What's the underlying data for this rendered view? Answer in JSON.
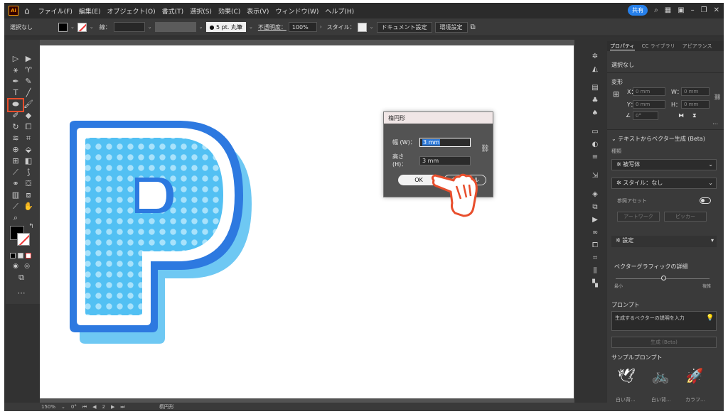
{
  "menubar": {
    "logo": "Ai",
    "items": [
      "ファイル(F)",
      "編集(E)",
      "オブジェクト(O)",
      "書式(T)",
      "選択(S)",
      "効果(C)",
      "表示(V)",
      "ウィンドウ(W)",
      "ヘルプ(H)"
    ],
    "share": "共有"
  },
  "control": {
    "selection": "選択なし",
    "stroke_label": "線：",
    "brush": "● 5 pt. 丸筆",
    "opacity_label": "不透明度：",
    "opacity_value": "100%",
    "style_label": "スタイル：",
    "doc_settings": "ドキュメント設定",
    "prefs": "環境設定"
  },
  "dialog": {
    "title": "楕円形",
    "width_label": "幅 (W)：",
    "width_value": "3 mm",
    "height_label": "高さ (H)：",
    "height_value": "3 mm",
    "ok": "OK",
    "cancel": "キャンセル"
  },
  "panel": {
    "tabs": [
      "プロパティ",
      "CC ライブラリ",
      "アピアランス"
    ],
    "selection": "選択なし",
    "transform": "変形",
    "x_label": "X：",
    "x_value": "0 mm",
    "w_label": "W：",
    "w_value": "0 mm",
    "y_label": "Y：",
    "y_value": "0 mm",
    "h_label": "H：",
    "h_value": "0 mm",
    "angle": "0°",
    "text_to_vector": "テキストからベクター生成 (Beta)",
    "type_label": "種類",
    "type_value": "被写体",
    "style_value": "スタイル：なし",
    "ref_asset": "参照アセット",
    "artwork_btn": "アートワーク",
    "picker_btn": "ピッカー",
    "settings": "設定",
    "detail_label": "ベクターグラフィックの詳細",
    "min_label": "最小",
    "max_label": "複雑",
    "prompt_label": "プロンプト",
    "prompt_placeholder": "生成するベクターの説明を入力",
    "generate_btn": "生成 (Beta)",
    "sample_label": "サンプルプロンプト",
    "samples": [
      "白い背...",
      "白い背...",
      "カラフ..."
    ]
  },
  "status": {
    "zoom": "150%",
    "rotation": "0°",
    "page": "2",
    "tool": "楕円形"
  },
  "colors": {
    "accent": "#2680eb",
    "highlight": "#e84e2c",
    "letter_blue": "#2d79e0",
    "letter_fill": "#52c0f3"
  }
}
